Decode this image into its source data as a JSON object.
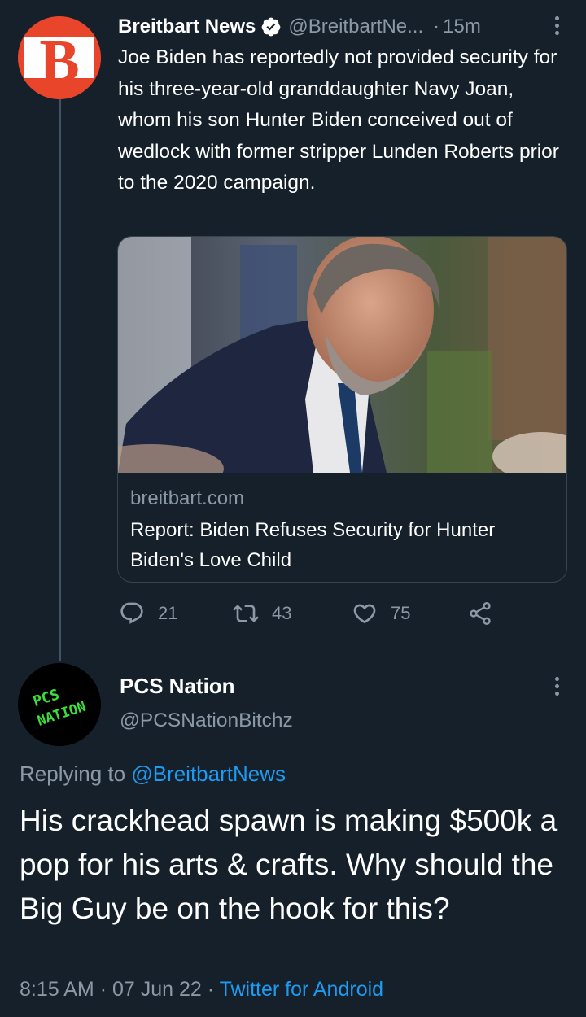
{
  "thread_tweet": {
    "author_name": "Breitbart News",
    "author_handle": "@BreitbartNe...",
    "separator": "·",
    "time_ago": "15m",
    "avatar_letter": "B",
    "text": "Joe Biden has reportedly not provided security for his three-year-old granddaughter Navy Joan, whom his son Hunter Biden conceived out of wedlock with former stripper Lunden Roberts prior to the 2020 campaign.",
    "card": {
      "domain": "breitbart.com",
      "title": "Report: Biden Refuses Security for Hunter Biden's Love Child"
    },
    "actions": {
      "replies": "21",
      "retweets": "43",
      "likes": "75"
    }
  },
  "focus_tweet": {
    "author_name": "PCS Nation",
    "author_handle": "@PCSNationBitchz",
    "avatar_text": [
      "PCS",
      "NATION"
    ],
    "replying_prefix": "Replying to",
    "replying_mention": "@BreitbartNews",
    "text": "His crackhead spawn is making $500k a pop for his arts & crafts. Why should the Big Guy be on the hook for this?",
    "timestamp_time": "8:15 AM",
    "timestamp_sep1": "·",
    "timestamp_date": "07 Jun 22",
    "timestamp_sep2": "·",
    "source": "Twitter for Android"
  },
  "colors": {
    "background": "#15202b",
    "text_primary": "#ffffff",
    "text_secondary": "#8b98a5",
    "link": "#1d9bf0",
    "verified": "#ffffff",
    "breitbart_orange": "#e8452a",
    "pcs_green": "#3bde3b"
  },
  "icons": [
    "verified-icon",
    "more-icon",
    "reply-icon",
    "retweet-icon",
    "like-icon",
    "share-icon"
  ]
}
